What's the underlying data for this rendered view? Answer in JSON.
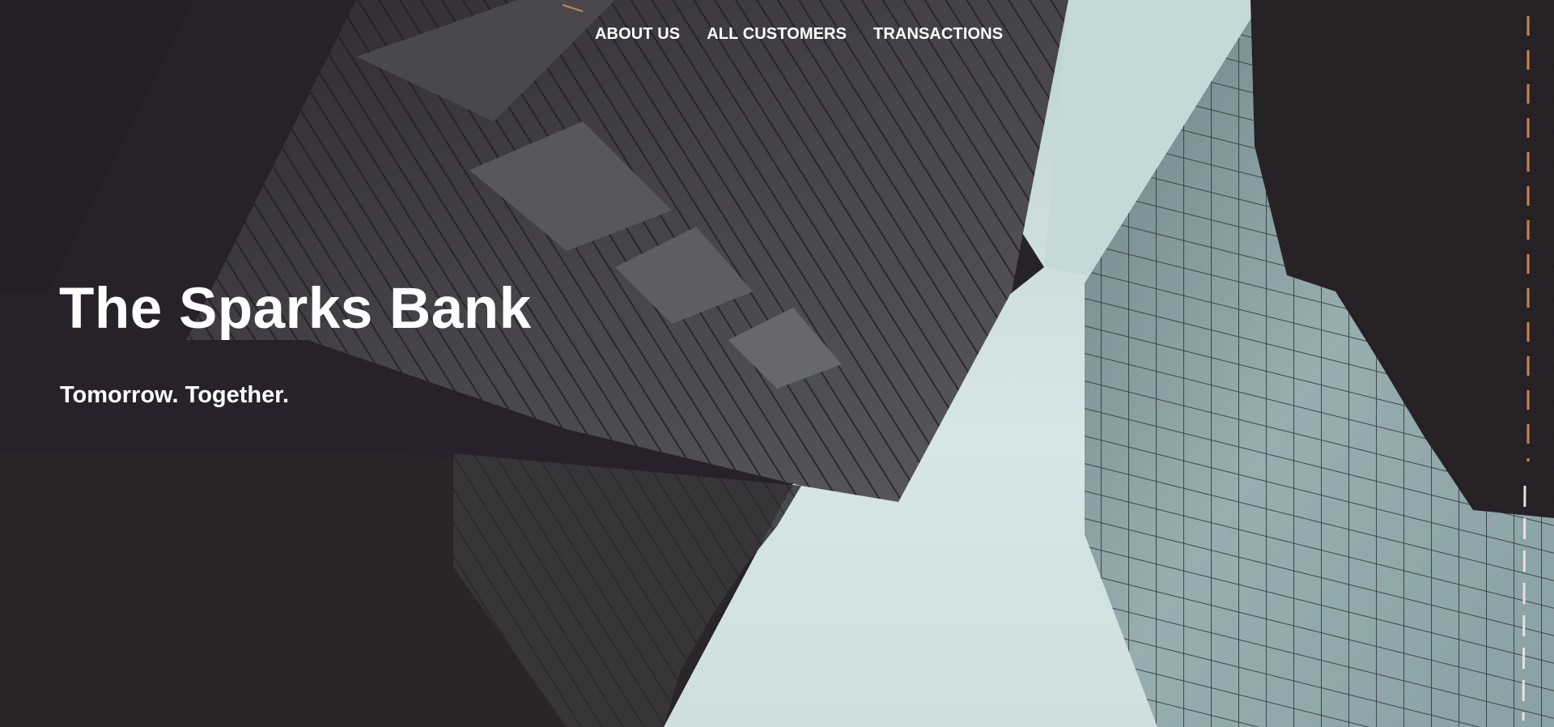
{
  "nav": {
    "items": [
      {
        "label": "ABOUT US"
      },
      {
        "label": "ALL CUSTOMERS"
      },
      {
        "label": "TRANSACTIONS"
      }
    ]
  },
  "hero": {
    "title": "The Sparks Bank",
    "tagline": "Tomorrow. Together.",
    "background_image": "skyscrapers-from-below"
  },
  "colors": {
    "page_background": "#272229",
    "sky": "#d3e3e2",
    "glass_building": "#8ea4a7",
    "text": "#ffffff"
  }
}
